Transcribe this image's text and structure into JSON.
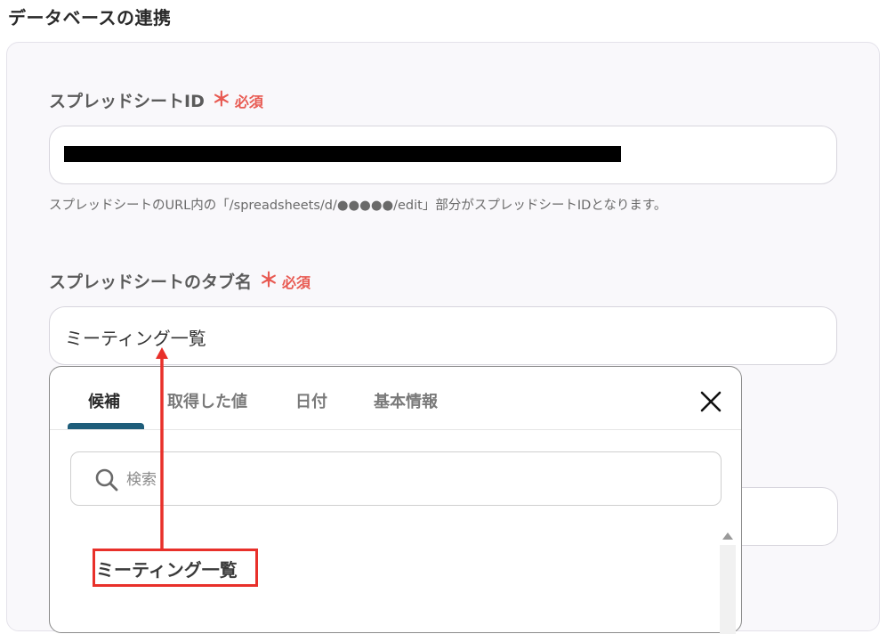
{
  "header": {
    "title": "データベースの連携"
  },
  "fields": {
    "sheet_id": {
      "label": "スプレッドシートID",
      "required_mark": "＊",
      "required_label": "必須",
      "help": "スプレッドシートのURL内の「/spreadsheets/d/●●●●●/edit」部分がスプレッドシートIDとなります。"
    },
    "tab_name": {
      "label": "スプレッドシートのタブ名",
      "required_mark": "＊",
      "required_label": "必須",
      "value": "ミーティング一覧"
    }
  },
  "dropdown": {
    "tabs": [
      {
        "label": "候補"
      },
      {
        "label": "取得した値"
      },
      {
        "label": "日付"
      },
      {
        "label": "基本情報"
      }
    ],
    "search_placeholder": "検索",
    "options": [
      {
        "label": "ミーティング一覧"
      }
    ]
  },
  "colors": {
    "required": "#e85a52",
    "tab_indicator": "#1e5d7a",
    "highlight": "#e8302a"
  }
}
